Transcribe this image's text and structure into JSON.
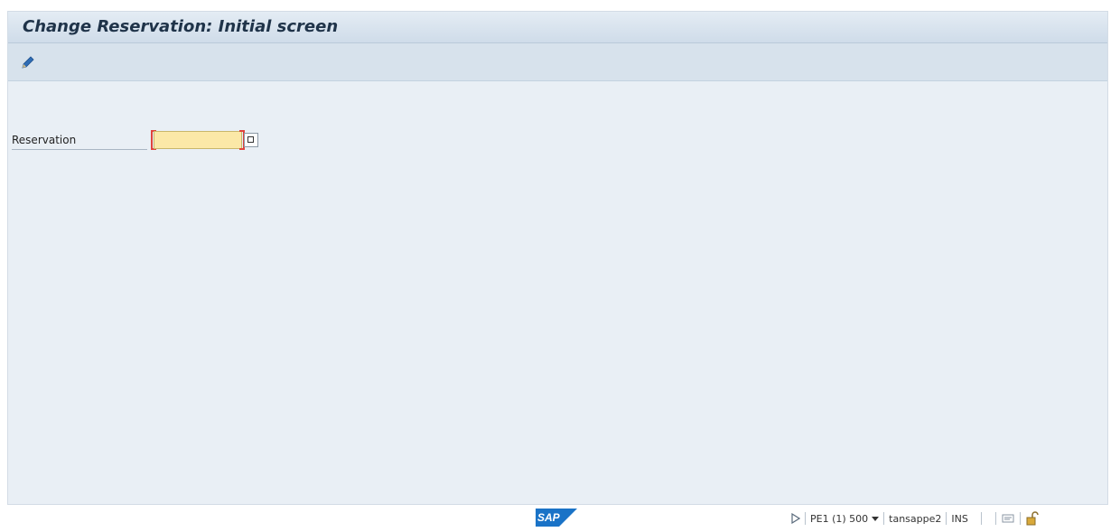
{
  "window": {
    "title": "Change Reservation: Initial screen"
  },
  "toolbar": {
    "edit_icon": "pencil-icon"
  },
  "form": {
    "reservation_label": "Reservation",
    "reservation_value": "",
    "value_help_icon": "value-help-icon"
  },
  "statusbar": {
    "logo": "SAP",
    "system_info": "PE1 (1) 500",
    "user": "tansappe2",
    "mode": "INS"
  },
  "colors": {
    "background": "#e9eff5",
    "required_field": "#fbe8a7",
    "required_marker": "#e0443c",
    "sap_blue": "#1a73c7"
  }
}
